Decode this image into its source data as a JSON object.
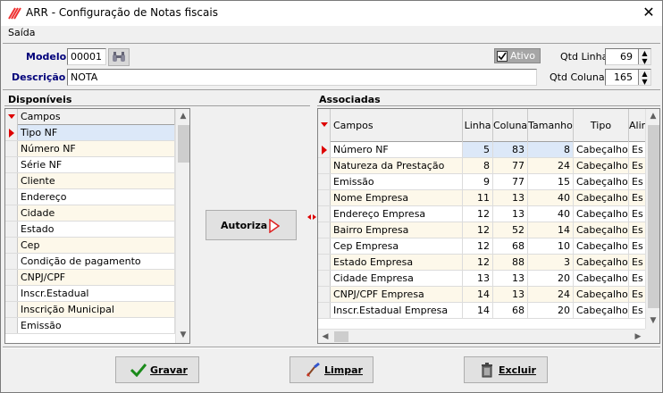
{
  "window": {
    "title": "ARR - Configuração de Notas fiscais",
    "close_glyph": "✕"
  },
  "menu": {
    "saida": "Saída"
  },
  "form": {
    "modelo_label": "Modelo",
    "modelo_value": "00001",
    "descricao_label": "Descrição",
    "descricao_value": "NOTA",
    "ativo_label": "Ativo",
    "ativo_checked": true,
    "qtd_linha_label": "Qtd Linha",
    "qtd_linha_value": "69",
    "qtd_colunas_label": "Qtd Colunas",
    "qtd_colunas_value": "165"
  },
  "disponiveis": {
    "title": "Disponíveis",
    "column": "Campos",
    "selected_index": 0,
    "items": [
      "Tipo NF",
      "Número NF",
      "Série NF",
      "Cliente",
      "Endereço",
      "Cidade",
      "Estado",
      "Cep",
      "Condição de pagamento",
      "CNPJ/CPF",
      "Inscr.Estadual",
      "Inscrição Municipal",
      "Emissão"
    ]
  },
  "associadas": {
    "title": "Associadas",
    "columns": [
      "Campos",
      "Linha",
      "Coluna",
      "Tamanho",
      "Tipo",
      "Alin"
    ],
    "selected_index": 0,
    "rows": [
      [
        "Número NF",
        "5",
        "83",
        "8",
        "Cabeçalho",
        "Es"
      ],
      [
        "Natureza da Prestação",
        "8",
        "77",
        "24",
        "Cabeçalho",
        "Es"
      ],
      [
        "Emissão",
        "9",
        "77",
        "15",
        "Cabeçalho",
        "Es"
      ],
      [
        "Nome Empresa",
        "11",
        "13",
        "40",
        "Cabeçalho",
        "Es"
      ],
      [
        "Endereço Empresa",
        "12",
        "13",
        "40",
        "Cabeçalho",
        "Es"
      ],
      [
        "Bairro Empresa",
        "12",
        "52",
        "14",
        "Cabeçalho",
        "Es"
      ],
      [
        "Cep Empresa",
        "12",
        "68",
        "10",
        "Cabeçalho",
        "Es"
      ],
      [
        "Estado Empresa",
        "12",
        "88",
        "3",
        "Cabeçalho",
        "Es"
      ],
      [
        "Cidade Empresa",
        "13",
        "13",
        "20",
        "Cabeçalho",
        "Es"
      ],
      [
        "CNPJ/CPF Empresa",
        "14",
        "13",
        "24",
        "Cabeçalho",
        "Es"
      ],
      [
        "Inscr.Estadual Empresa",
        "14",
        "68",
        "20",
        "Cabeçalho",
        "Es"
      ]
    ]
  },
  "buttons": {
    "autoriza": "Autoriza",
    "gravar": "Gravar",
    "limpar": "Limpar",
    "excluir": "Excluir"
  },
  "colors": {
    "label_blue": "#00007a",
    "row_alt": "#fdf8ea",
    "selected_row": "#dce8f8",
    "indicator_red": "#dd0000",
    "check_green": "#1a8a1a"
  }
}
